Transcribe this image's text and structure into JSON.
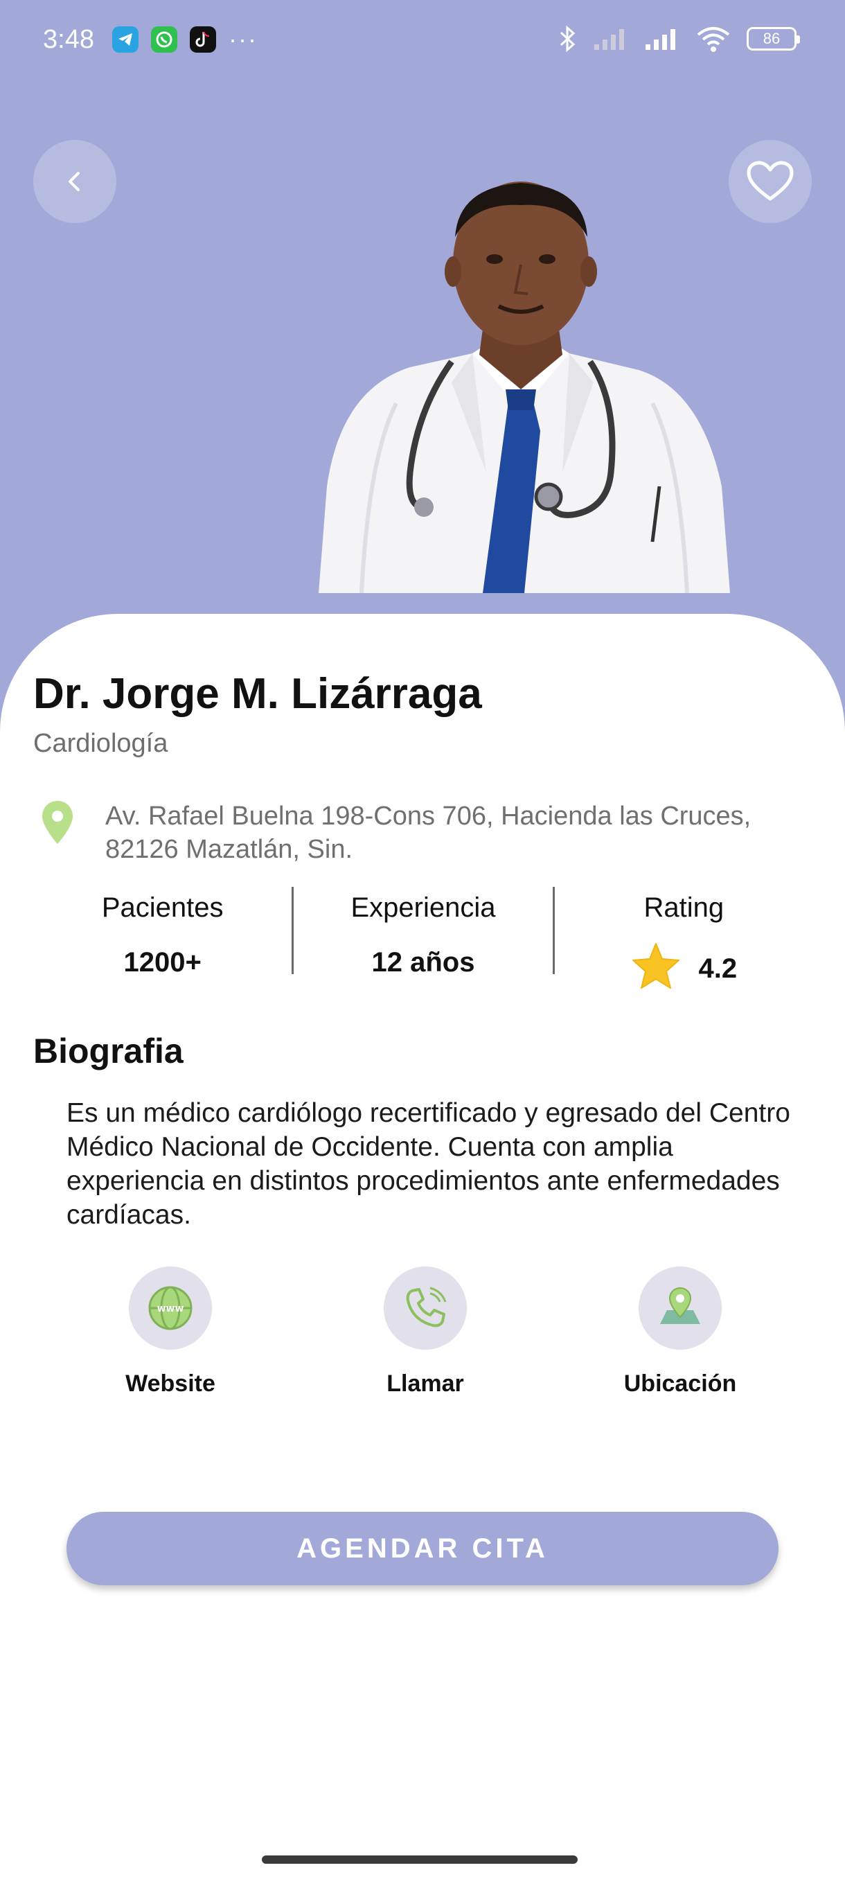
{
  "status_bar": {
    "time": "3:48",
    "apps": [
      "telegram-icon",
      "whatsapp-icon",
      "tiktok-icon"
    ],
    "more": "···",
    "battery": "86"
  },
  "doctor": {
    "name": "Dr. Jorge M. Lizárraga",
    "specialty": "Cardiología",
    "address": "Av. Rafael Buelna 198-Cons 706, Hacienda las Cruces, 82126 Mazatlán, Sin."
  },
  "stats": [
    {
      "label": "Pacientes",
      "value": "1200+"
    },
    {
      "label": "Experiencia",
      "value": "12 años"
    },
    {
      "label": "Rating",
      "value": "4.2"
    }
  ],
  "biography": {
    "title": "Biografia",
    "text": "Es un médico cardiólogo recertificado y egresado del Centro Médico Nacional de Occidente. Cuenta con amplia experiencia en distintos procedimientos ante enfermedades cardíacas."
  },
  "actions": [
    {
      "label": "Website",
      "icon": "globe-www-icon"
    },
    {
      "label": "Llamar",
      "icon": "phone-icon"
    },
    {
      "label": "Ubicación",
      "icon": "map-pin-icon"
    }
  ],
  "cta": {
    "label": "AGENDAR CITA"
  },
  "colors": {
    "accent": "#a2a9d8",
    "card": "#ffffff",
    "star": "#f7c424",
    "pin": "#b8e08b",
    "action_bg": "#e1e0eb"
  }
}
